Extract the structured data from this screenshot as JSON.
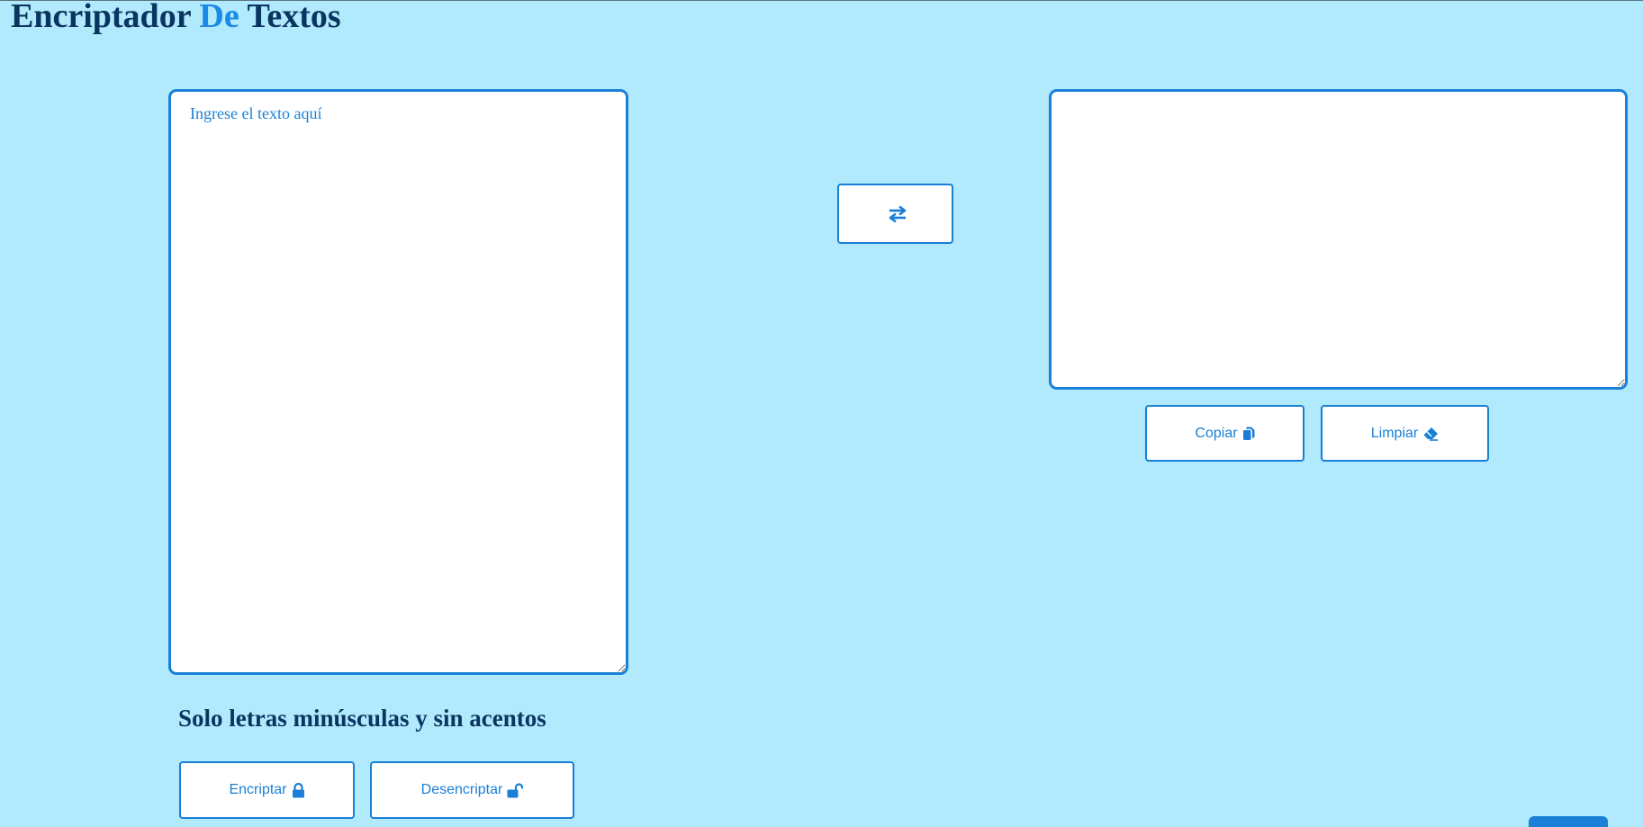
{
  "header": {
    "title_part1": "Encriptador ",
    "title_accent": "De",
    "title_part3": " Textos"
  },
  "input": {
    "placeholder": "Ingrese el texto aquí",
    "value": ""
  },
  "output": {
    "value": ""
  },
  "hint": "Solo letras minúsculas y sin acentos",
  "buttons": {
    "swap": "",
    "copy": "Copiar",
    "clear": "Limpiar",
    "encrypt": "Encriptar",
    "decrypt": "Desencriptar"
  },
  "icons": {
    "swap": "arrows-swap-icon",
    "copy": "copy-icon",
    "clear": "eraser-icon",
    "encrypt": "lock-icon",
    "decrypt": "unlock-icon"
  },
  "colors": {
    "background": "#b0eafc",
    "accent": "#1a7fd6",
    "title": "#0b3561",
    "title_accent": "#1a8ae6"
  }
}
